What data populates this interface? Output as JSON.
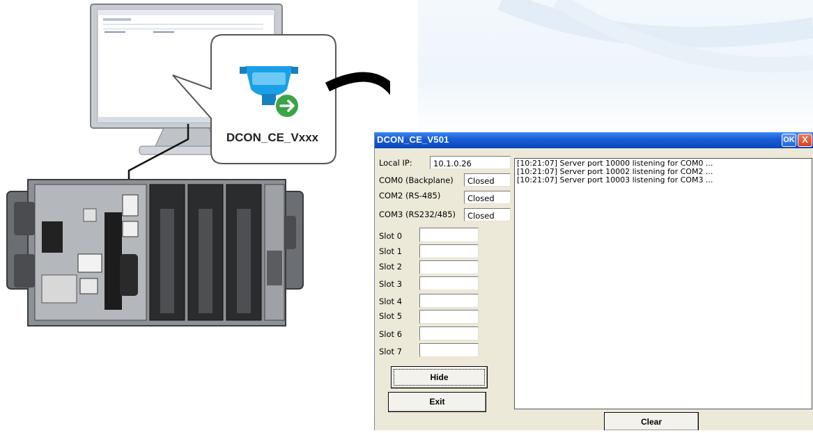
{
  "illustration": {
    "callout_label": "DCON_CE_Vxxx",
    "colors": {
      "arrow": "#000000",
      "icon_blue": "#1aa0e8",
      "icon_green": "#3aa447"
    }
  },
  "window": {
    "title": "DCON_CE_V501",
    "ok_label": "OK",
    "close_label": "X",
    "local_ip": {
      "label": "Local IP:",
      "value": "10.1.0.26"
    },
    "ports": [
      {
        "label": "COM0 (Backplane)",
        "status": "Closed"
      },
      {
        "label": "COM2 (RS-485)",
        "status": "Closed"
      },
      {
        "label": "COM3 (RS232/485)",
        "status": "Closed"
      }
    ],
    "slots": [
      {
        "label": "Slot 0",
        "value": ""
      },
      {
        "label": "Slot 1",
        "value": ""
      },
      {
        "label": "Slot 2",
        "value": ""
      },
      {
        "label": "Slot 3",
        "value": ""
      },
      {
        "label": "Slot 4",
        "value": ""
      },
      {
        "label": "Slot 5",
        "value": ""
      },
      {
        "label": "Slot 6",
        "value": ""
      },
      {
        "label": "Slot 7",
        "value": ""
      }
    ],
    "log": [
      "[10:21:07] Server port 10000 listening for COM0 ...",
      "[10:21:07] Server port 10002 listening for COM2 ...",
      "[10:21:07] Server port 10003 listening for COM3 ..."
    ],
    "buttons": {
      "hide": "Hide",
      "exit": "Exit",
      "clear": "Clear"
    },
    "colors": {
      "titlebar": "#1c5fd6",
      "face": "#ece9d8",
      "close": "#d7421c"
    }
  }
}
